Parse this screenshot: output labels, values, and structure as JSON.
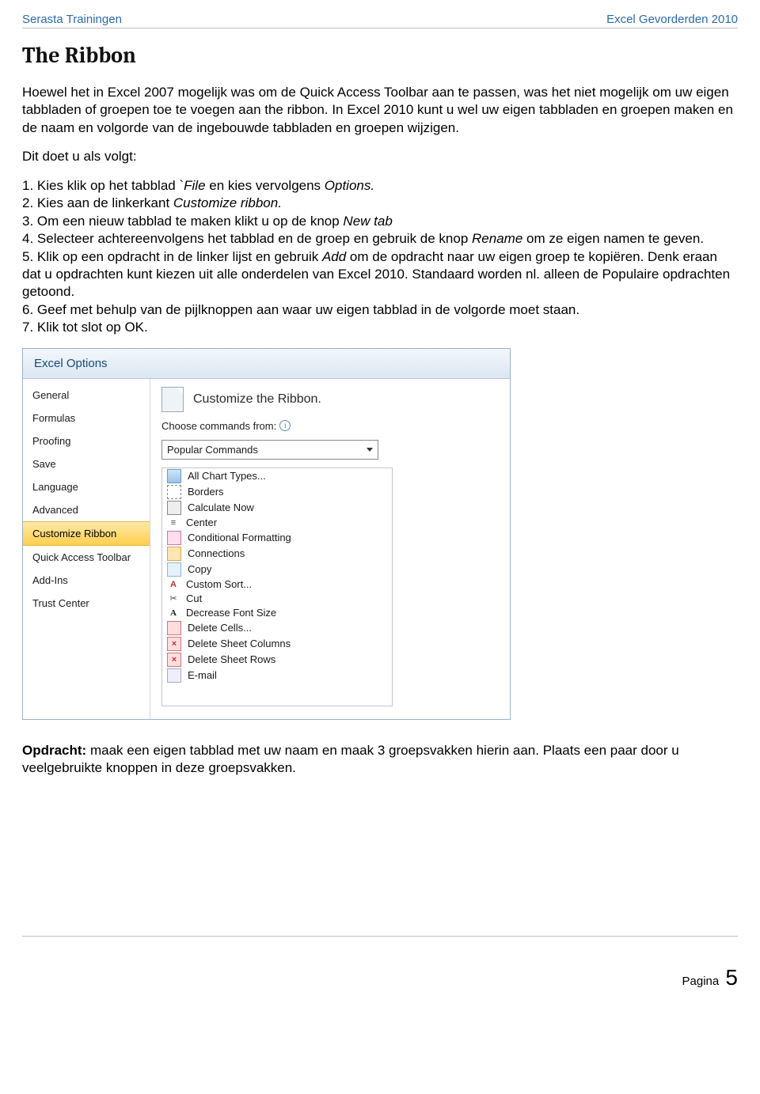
{
  "header": {
    "left": "Serasta Trainingen",
    "right": "Excel Gevorderden 2010"
  },
  "title": "The Ribbon",
  "intro": "Hoewel het in Excel 2007 mogelijk was om de Quick Access Toolbar aan te passen, was het niet mogelijk om uw eigen tabbladen of groepen toe te voegen aan the ribbon. In Excel 2010 kunt u wel uw eigen tabbladen en groepen maken en de naam en volgorde van de ingebouwde tabbladen en groepen wijzigen.",
  "lead": "Dit doet u als volgt:",
  "steps": {
    "s1a": "1. Kies klik op het tabblad `",
    "s1file": "File",
    "s1b": " en kies vervolgens ",
    "s1opt": "Options.",
    "s2a": "2. Kies aan de linkerkant ",
    "s2cr": "Customize ribbon.",
    "s3a": "3. Om een nieuw tabblad te maken klikt u op de knop ",
    "s3nt": "New tab",
    "s4a": "4. Selecteer achtereenvolgens het tabblad en de groep en gebruik de knop ",
    "s4rn": "Rename",
    "s4b": " om ze eigen namen te geven.",
    "s5a": "5. Klik op een opdracht in de linker lijst en gebruik ",
    "s5add": "Add",
    "s5b": " om de opdracht naar uw eigen groep te kopiëren. Denk eraan dat u opdrachten kunt kiezen uit alle onderdelen van Excel 2010. Standaard worden nl. alleen de Populaire opdrachten getoond.",
    "s6": "6. Geef met behulp van de pijlknoppen aan waar uw eigen tabblad in de volgorde moet staan.",
    "s7": "7. Klik tot slot op OK."
  },
  "dialog": {
    "title": "Excel Options",
    "nav": [
      "General",
      "Formulas",
      "Proofing",
      "Save",
      "Language",
      "Advanced",
      "Customize Ribbon",
      "Quick Access Toolbar",
      "Add-Ins",
      "Trust Center"
    ],
    "nav_selected": "Customize Ribbon",
    "heading": "Customize the Ribbon.",
    "choose_label": "Choose commands from:",
    "dropdown": "Popular Commands",
    "commands": [
      "All Chart Types...",
      "Borders",
      "Calculate Now",
      "Center",
      "Conditional Formatting",
      "Connections",
      "Copy",
      "Custom Sort...",
      "Cut",
      "Decrease Font Size",
      "Delete Cells...",
      "Delete Sheet Columns",
      "Delete Sheet Rows",
      "E-mail"
    ]
  },
  "assignment_label": "Opdracht:",
  "assignment_text": " maak een eigen tabblad met uw naam en maak 3 groepsvakken hierin aan. Plaats een paar door u veelgebruikte knoppen in deze groepsvakken.",
  "footer": {
    "label": "Pagina",
    "num": "5"
  }
}
